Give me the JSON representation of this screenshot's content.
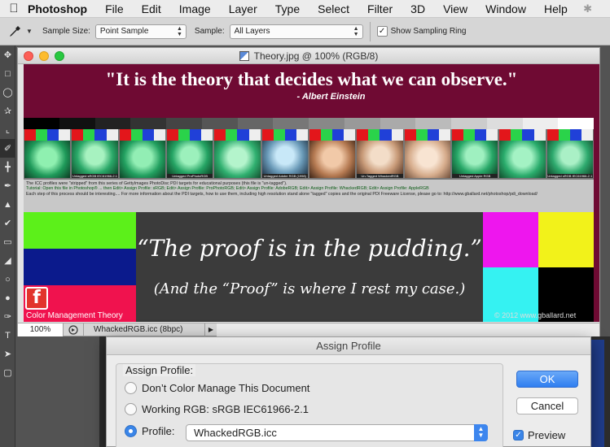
{
  "menubar": {
    "app_name": "Photoshop",
    "items": [
      "File",
      "Edit",
      "Image",
      "Layer",
      "Type",
      "Select",
      "Filter",
      "3D",
      "View",
      "Window",
      "Help"
    ]
  },
  "options_bar": {
    "tool_icon": "eyedropper-icon",
    "sample_size_label": "Sample Size:",
    "sample_size_value": "Point Sample",
    "sample_label": "Sample:",
    "sample_value": "All Layers",
    "show_ring_label": "Show Sampling Ring",
    "show_ring_checked": true
  },
  "document": {
    "title": "Theory.jpg @ 100% (RGB/8)",
    "quote": "\"It is the theory that decides what we can observe.\"",
    "author": "- Albert Einstein",
    "caption_line1": "The ICC profiles were \"stripped\" from this series of GettyImages PhotoDisc PDI targets for educational purposes (this file is \"un-tagged\").",
    "caption_line2": "Tutorial: Open this file in Photoshop® ... then Edit> Assign Profile: sRGB; Edit> Assign Profile: ProPhotoRGB; Edit> Assign Profile: AdobeRGB; Edit> Assign Profile: WhackedRGB; Edit> Assign Profile: AppleRGB",
    "caption_line3": "Each step of this process should be interesting.... For more information about the PDI targets, how to use them, including high resolution stand alone \"tagged\" copies and the original PDI Freeware License, please go to: http://www.gballard.net/photoshop/pdi_download/",
    "thumb_labels": [
      "Untagged sRGB IEC61966-2.1",
      "Untagged ProPhotoRGB",
      "Untagged Adobe RGB (1998)",
      "Un-Tagged WhackedRGB",
      "Untagged Apple RGB"
    ],
    "pudding_line1": "“The proof is in the pudding.”",
    "pudding_line2": "(And the “Proof” is where I rest my case.)",
    "cm_theory": "Color Management Theory",
    "copyright": "© 2012 www.gballard.net",
    "status_zoom": "100%",
    "status_info": "WhackedRGB.icc (8bpc)"
  },
  "dialog": {
    "title": "Assign Profile",
    "group_label": "Assign Profile:",
    "option_dont": "Don’t Color Manage This Document",
    "option_working": "Working RGB:  sRGB IEC61966-2.1",
    "option_profile": "Profile:",
    "profile_value": "WhackedRGB.icc",
    "ok_label": "OK",
    "cancel_label": "Cancel",
    "preview_label": "Preview",
    "preview_checked": true,
    "selected_option": "profile"
  },
  "colors": {
    "canvas_bg": "#6f0a33",
    "green": "#5cf01a",
    "blue": "#0b1a8c",
    "red": "#f0124e",
    "magenta": "#ee16ee",
    "yellow": "#f2f21a",
    "cyan": "#35f2f2",
    "black": "#000000"
  }
}
